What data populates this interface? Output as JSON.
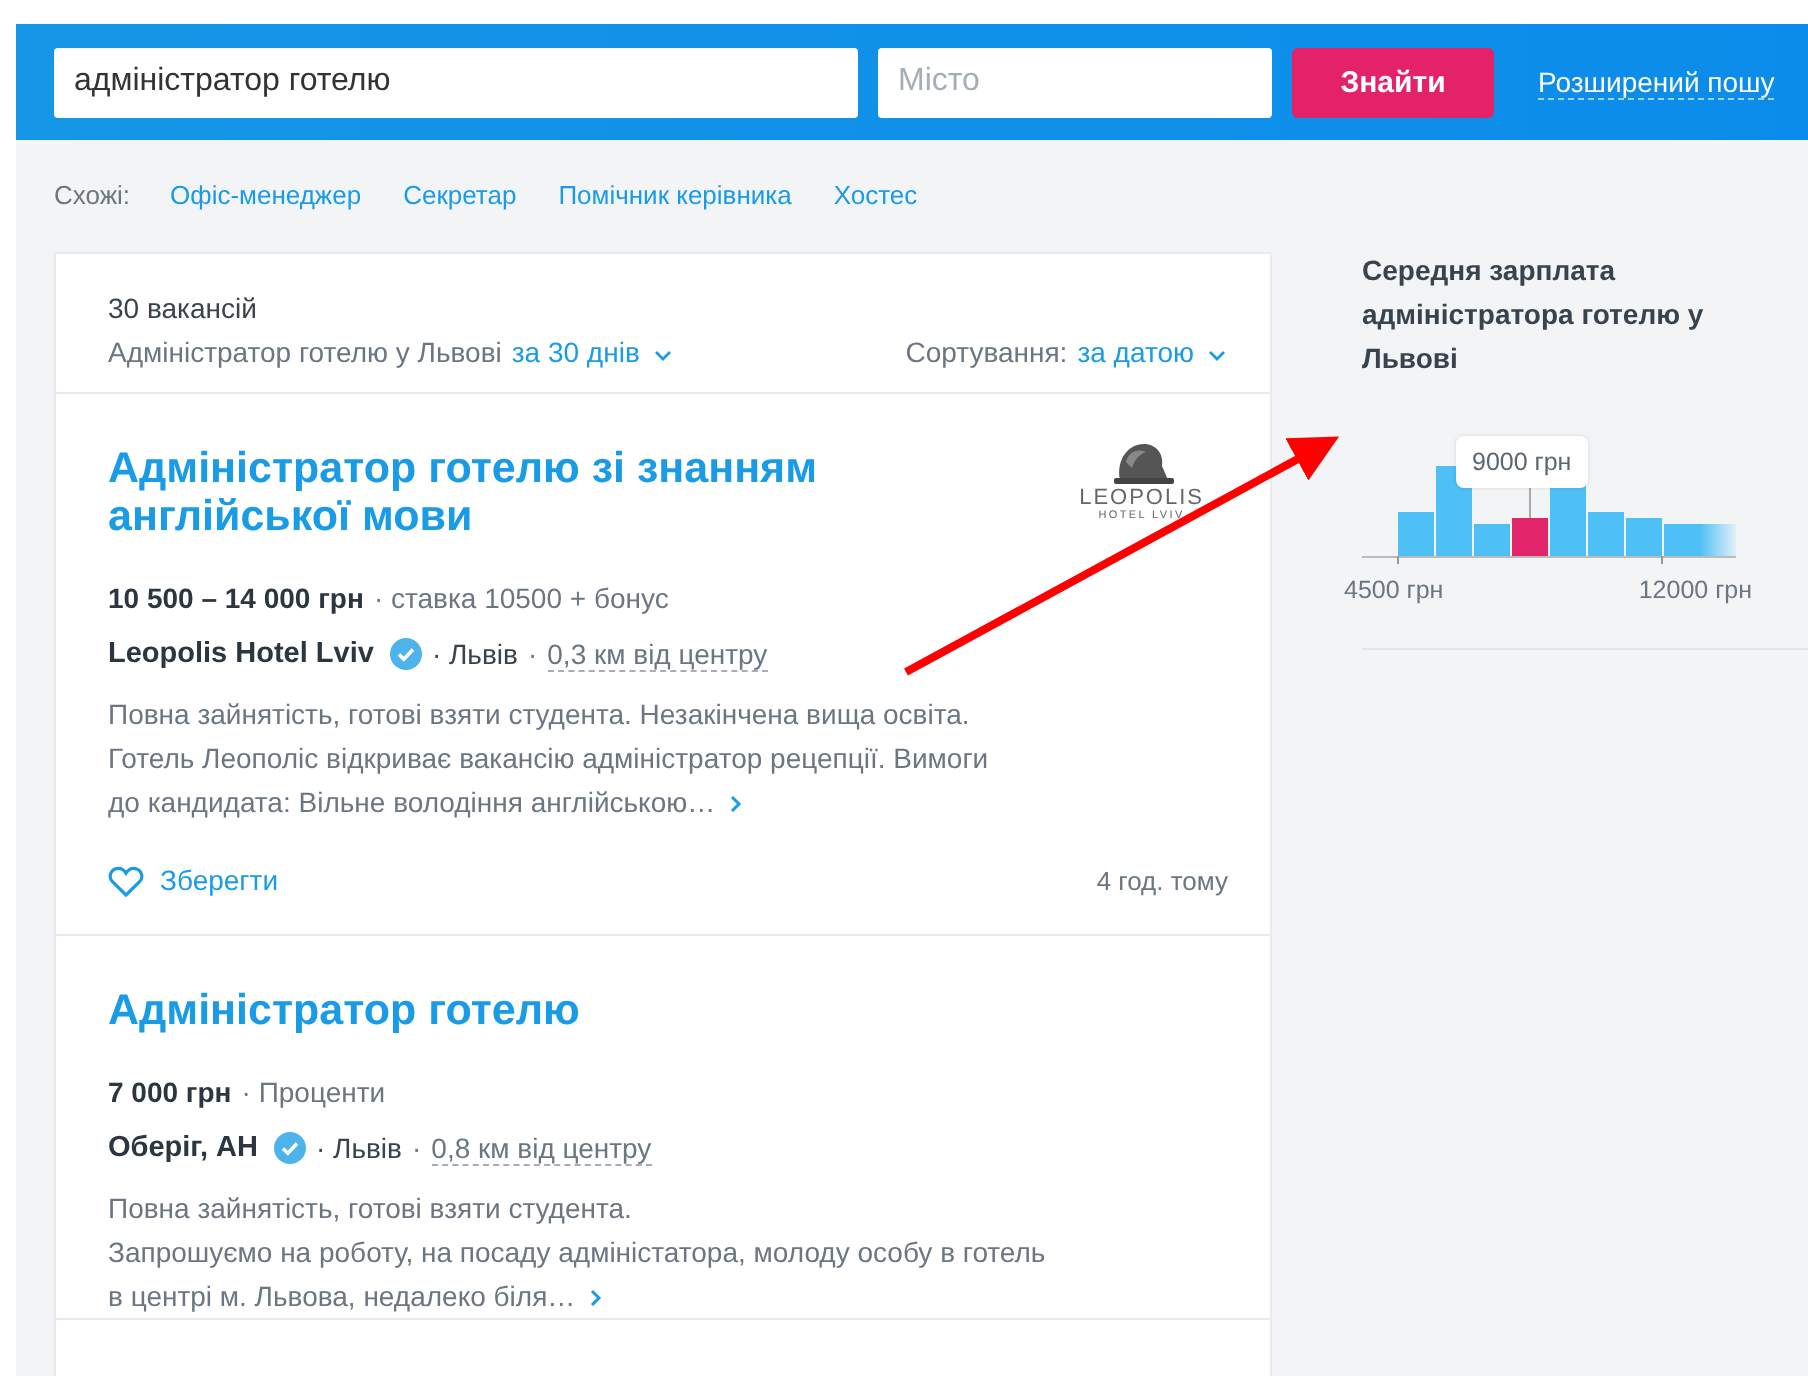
{
  "search": {
    "query": "адміністратор готелю",
    "city_placeholder": "Місто",
    "button": "Знайти",
    "advanced_link": "Розширений пошу"
  },
  "similar": {
    "label": "Схожі:",
    "links": [
      "Офіс-менеджер",
      "Секретар",
      "Помічник керівника",
      "Хостес"
    ]
  },
  "results": {
    "count": "30 вакансій",
    "summary": "Адміністратор готелю у Львові",
    "period": "за 30 днів",
    "sort_label": "Сортування:",
    "sort_value": "за датою"
  },
  "jobs": [
    {
      "title": "Адміністратор готелю зі знанням англійської мови",
      "salary": "10 500 – 14 000 грн",
      "salary_note": "· ставка 10500 + бонус",
      "company": "Leopolis Hotel Lviv",
      "verified": true,
      "city": "· Львів",
      "separator": "·",
      "distance": "0,3 км від центру",
      "description": [
        "Повна зайнятість, готові взяти студента. Незакінчена вища освіта.",
        "Готель Леополіс відкриває вакансію адміністратор рецепції. Вимоги",
        "до кандидата: Вільне володіння англійською…"
      ],
      "logo": {
        "name": "LEOPOLIS",
        "sub": "HOTEL LVIV"
      },
      "save": "Зберегти",
      "time": "4 год. тому"
    },
    {
      "title": "Адміністратор готелю",
      "salary": "7 000 грн",
      "salary_note": "· Проценти",
      "company": "Оберіг, АН",
      "verified": true,
      "city": "· Львів",
      "separator": "·",
      "distance": "0,8 км від центру",
      "description": [
        "Повна зайнятість, готові взяти студента.",
        "Запрошуємо на роботу, на посаду адміністатора, молоду особу в готель",
        "в центрі м. Львова, недалеко біля…"
      ]
    }
  ],
  "salary_panel": {
    "title": "Середня зарплата адміністратора готелю у Львові",
    "tooltip": "9000 грн",
    "axis_min": "4500 грн",
    "axis_max": "12000 грн"
  }
}
